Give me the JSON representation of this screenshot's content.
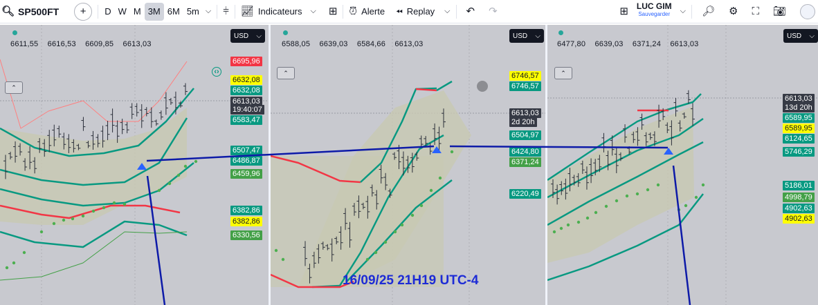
{
  "toolbar": {
    "symbol": "SP500FT",
    "timeframes": [
      "D",
      "W",
      "M",
      "3M",
      "6M",
      "5m"
    ],
    "active_timeframe": "3M",
    "indicators_label": "Indicateurs",
    "alert_label": "Alerte",
    "replay_label": "Replay",
    "user_name": "LUC GIM",
    "save_label": "Sauvegarder"
  },
  "colors": {
    "upper_band": "#089981",
    "lower_band": "#f23645",
    "trend_line": "#0d1aa8",
    "channel_fill": "#c8c9b2",
    "dots": "#4caf50"
  },
  "panels": [
    {
      "currency": "USD",
      "ohlc": [
        "6611,55",
        "6616,53",
        "6609,85",
        "6613,03"
      ],
      "price_tags": [
        {
          "text": "6695,96",
          "style": "red"
        },
        {
          "text": "6632,08",
          "style": "yellow"
        },
        {
          "text": "6632,08",
          "style": "green"
        },
        {
          "text": "6613,03",
          "style": "dark"
        },
        {
          "text": "19:40:07",
          "style": "dark"
        },
        {
          "text": "6583,47",
          "style": "green"
        },
        {
          "text": "6507,47",
          "style": "green"
        },
        {
          "text": "6486,87",
          "style": "green"
        },
        {
          "text": "6459,96",
          "style": "lightgreen"
        },
        {
          "text": "6382,86",
          "style": "green"
        },
        {
          "text": "6382,86",
          "style": "yellow"
        },
        {
          "text": "6330,56",
          "style": "lightgreen"
        }
      ]
    },
    {
      "currency": "USD",
      "ohlc": [
        "6588,05",
        "6639,03",
        "6584,66",
        "6613,03"
      ],
      "price_tags": [
        {
          "text": "6746,57",
          "style": "yellow"
        },
        {
          "text": "6746,57",
          "style": "green"
        },
        {
          "text": "6613,03",
          "style": "dark"
        },
        {
          "text": "2d 20h",
          "style": "dark"
        },
        {
          "text": "6504,97",
          "style": "green"
        },
        {
          "text": "6424,80",
          "style": "green"
        },
        {
          "text": "6371,24",
          "style": "lightgreen"
        },
        {
          "text": "6220,49",
          "style": "green"
        }
      ]
    },
    {
      "currency": "USD",
      "ohlc": [
        "6477,80",
        "6639,03",
        "6371,24",
        "6613,03"
      ],
      "price_tags": [
        {
          "text": "6613,03",
          "style": "dark"
        },
        {
          "text": "13d 20h",
          "style": "dark"
        },
        {
          "text": "6589,95",
          "style": "green"
        },
        {
          "text": "6589,95",
          "style": "yellow"
        },
        {
          "text": "6124,65",
          "style": "green"
        },
        {
          "text": "5746,29",
          "style": "green"
        },
        {
          "text": "5186,01",
          "style": "green"
        },
        {
          "text": "4998,79",
          "style": "lightgreen"
        },
        {
          "text": "4902,63",
          "style": "green"
        },
        {
          "text": "4902,63",
          "style": "yellow"
        }
      ]
    }
  ],
  "annotation": "16/09/25 21H19 UTC-4"
}
